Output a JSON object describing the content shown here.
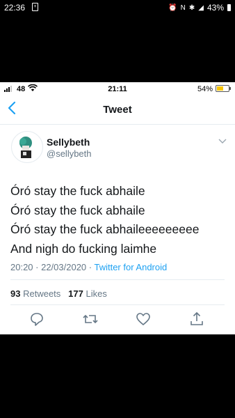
{
  "android_status": {
    "time": "22:36",
    "battery": "43%"
  },
  "ios_status": {
    "carrier_signal": "48",
    "time": "21:11",
    "battery": "54%"
  },
  "nav": {
    "back_icon": "chevron-left-icon",
    "title": "Tweet"
  },
  "tweet": {
    "name": "Sellybeth",
    "handle": "@sellybeth",
    "lines": [
      "Óró stay the fuck abhaile",
      "Óró stay the fuck abhaile",
      "Óró stay the fuck abhaileeeeeeeee",
      "And nigh do fucking laimhe"
    ],
    "timestamp": "20:20 · 22/03/2020 · ",
    "source": "Twitter for Android",
    "retweets_count": "93",
    "retweets_label": "Retweets",
    "likes_count": "177",
    "likes_label": "Likes"
  },
  "actions": [
    "reply-icon",
    "retweet-icon",
    "like-icon",
    "share-icon"
  ],
  "colors": {
    "accent": "#1da1f2",
    "secondary_text": "#657786",
    "battery": "#f5c400"
  }
}
